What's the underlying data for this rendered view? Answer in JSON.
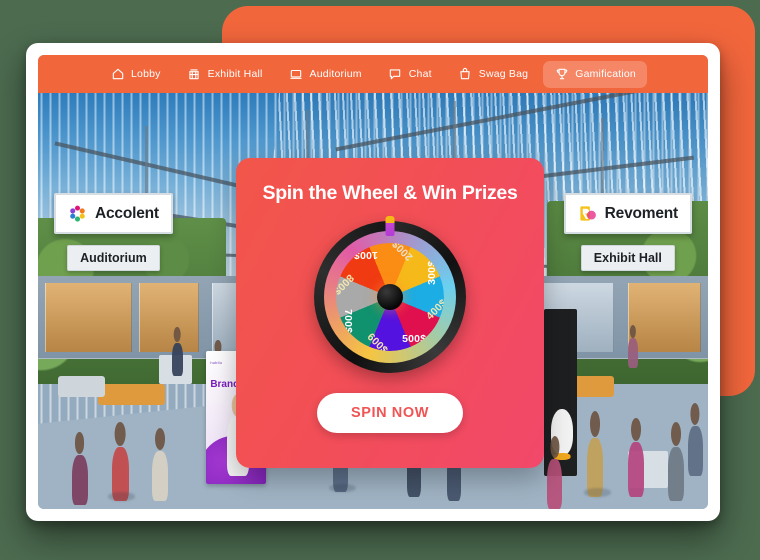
{
  "theme": {
    "page_background": "#4c6b4f",
    "accent_orange": "#f2663c",
    "modal_gradient_from": "#f2564a",
    "modal_gradient_to": "#f2486a",
    "button_text_color": "#f05454"
  },
  "nav": {
    "items": [
      {
        "label": "Lobby",
        "icon": "home-icon",
        "active": false
      },
      {
        "label": "Exhibit Hall",
        "icon": "storefront-icon",
        "active": false
      },
      {
        "label": "Auditorium",
        "icon": "laptop-icon",
        "active": false
      },
      {
        "label": "Chat",
        "icon": "chat-bubble-icon",
        "active": false
      },
      {
        "label": "Swag Bag",
        "icon": "shopping-bag-icon",
        "active": false
      },
      {
        "label": "Gamification",
        "icon": "trophy-icon",
        "active": true
      }
    ]
  },
  "venue_signs": {
    "left": {
      "brand": "Accolent",
      "logo": "accolent-flower-logo",
      "sub_label": "Auditorium"
    },
    "right": {
      "brand": "Revoment",
      "logo": "revoment-r-logo",
      "sub_label": "Exhibit Hall"
    }
  },
  "scene_banner": {
    "logo_text": "hubilo",
    "headline": "Brand\nV"
  },
  "modal": {
    "title": "Spin the Wheel & Win Prizes",
    "spin_button_label": "SPIN NOW",
    "pointer_icon": "wheel-pointer-icon",
    "wheel": {
      "segment_count": 8,
      "segments": [
        {
          "label": "100$",
          "color": "#fb8c14",
          "text_color": "#ffffff",
          "start_deg": 0
        },
        {
          "label": "200$",
          "color": "#f6b91a",
          "text_color": "#e8e0c8",
          "start_deg": 45
        },
        {
          "label": "300$",
          "color": "#1cade4",
          "text_color": "#ffffff",
          "start_deg": 90
        },
        {
          "label": "400$",
          "color": "#e0104f",
          "text_color": "#f3e6b0",
          "start_deg": 135
        },
        {
          "label": "500$",
          "color": "#5412e0",
          "text_color": "#ffffff",
          "start_deg": 180
        },
        {
          "label": "600$",
          "color": "#10926f",
          "text_color": "#f3e6b0",
          "start_deg": 225
        },
        {
          "label": "700$",
          "color": "#a9a9a9",
          "text_color": "#ffffff",
          "start_deg": 270
        },
        {
          "label": "800$",
          "color": "#f03a12",
          "text_color": "#f3e6b0",
          "start_deg": 315
        }
      ],
      "rim_colors": [
        "#f5c542",
        "#e25aa6",
        "#6ad0f0"
      ],
      "hub_color": "#0a0a0a"
    }
  }
}
